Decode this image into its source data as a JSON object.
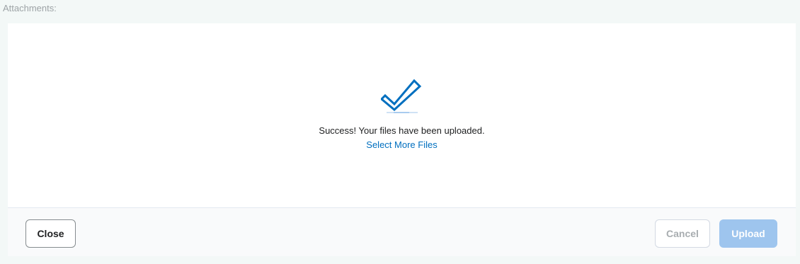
{
  "header": {
    "attachments_label": "Attachments:"
  },
  "dialog": {
    "success_message": "Success! Your files have been uploaded.",
    "select_more_link": "Select More Files",
    "success_icon": "checkmark-icon"
  },
  "footer": {
    "close_label": "Close",
    "cancel_label": "Cancel",
    "upload_label": "Upload"
  },
  "colors": {
    "accent": "#006fbf",
    "upload_disabled": "#9ec5ee",
    "text": "#202122",
    "muted": "#9da3a6"
  }
}
